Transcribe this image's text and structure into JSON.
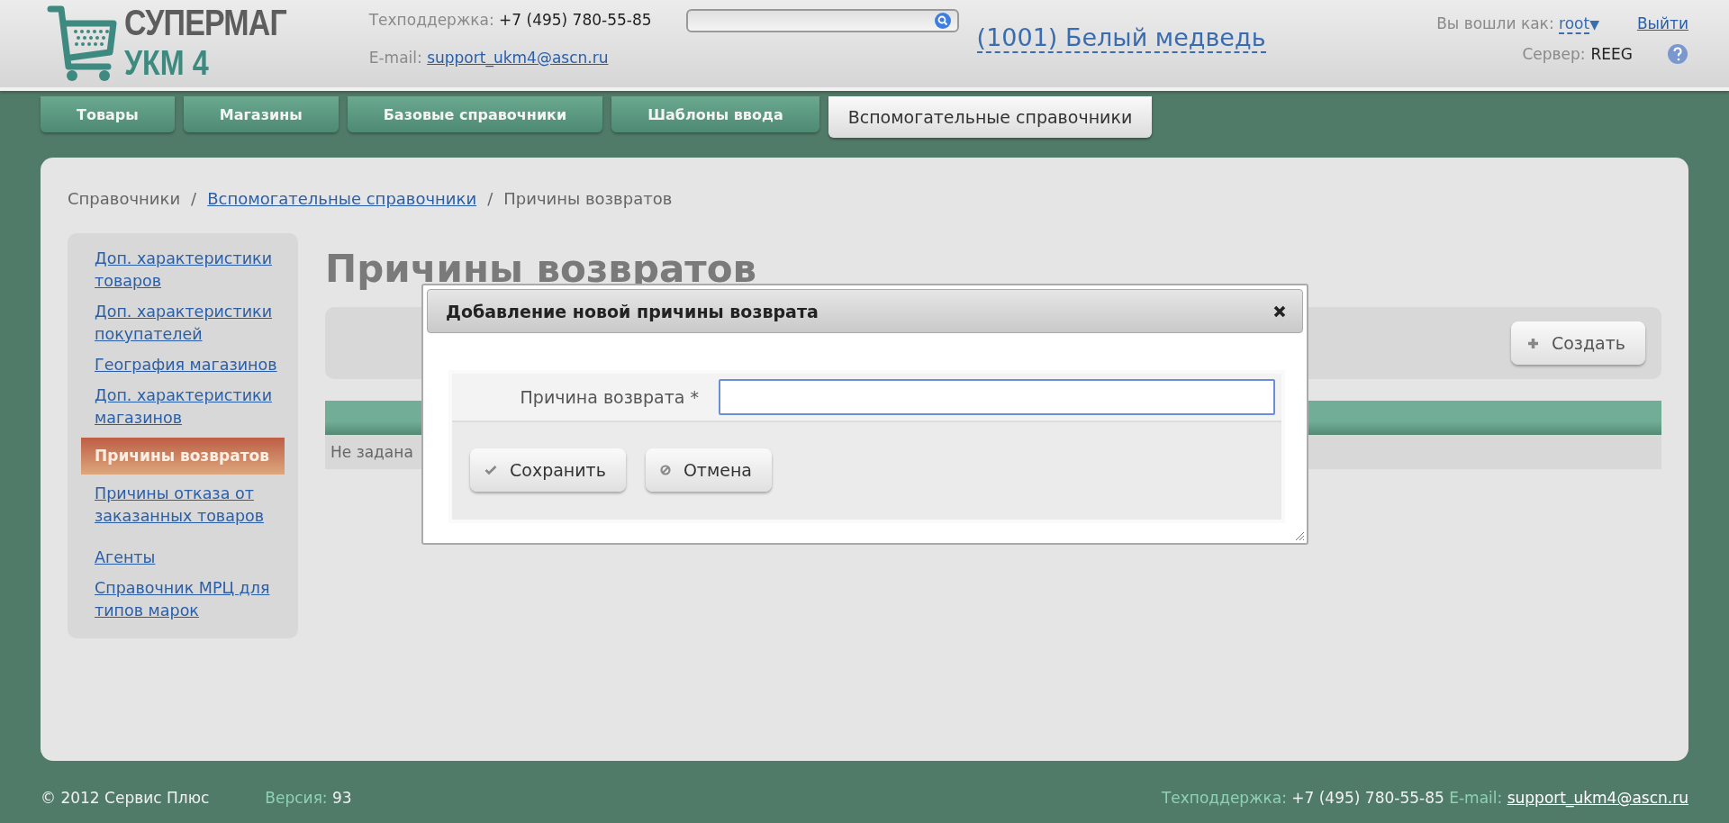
{
  "header": {
    "logo": {
      "line_1": "СУПЕРМАГ",
      "line_2": "УКМ 4"
    },
    "support_label": "Техподдержка:",
    "support_phone": "+7 (495) 780-55-85",
    "email_label": "E-mail:",
    "email": "support_ukm4@ascn.ru",
    "store": "(1001) Белый медведь",
    "user_label": "Вы вошли как:",
    "user": "root",
    "user_caret": "▼",
    "logout": "Выйти",
    "server_label": "Сервер:",
    "server": "REEG"
  },
  "tabs": [
    {
      "label": "Товары",
      "selected": false
    },
    {
      "label": "Магазины",
      "selected": false
    },
    {
      "label": "Базовые справочники",
      "selected": false
    },
    {
      "label": "Шаблоны ввода",
      "selected": false
    },
    {
      "label": "Вспомогательные справочники",
      "selected": true
    }
  ],
  "breadcrumb": {
    "separator": "/",
    "items": [
      {
        "label": "Справочники",
        "link": false
      },
      {
        "label": "Вспомогательные справочники",
        "link": true
      },
      {
        "label": "Причины возвратов",
        "link": false
      }
    ]
  },
  "sidebar": {
    "items": [
      {
        "label": "Доп. характеристики товаров",
        "selected": false
      },
      {
        "label": "Доп. характеристики покупателей",
        "selected": false
      },
      {
        "label": "География магазинов",
        "selected": false
      },
      {
        "label": "Доп. характеристики магазинов",
        "selected": false
      },
      {
        "label": "Причины возвратов",
        "selected": true
      },
      {
        "label": "Причины отказа от заказанных товаров",
        "selected": false
      },
      {
        "label": "Агенты",
        "selected": false
      },
      {
        "label": "Справочник МРЦ для типов марок",
        "selected": false
      }
    ]
  },
  "page": {
    "title": "Причины возвратов",
    "create_button": "Создать",
    "table": {
      "rows": [
        {
          "cell_1": "Не задана"
        }
      ]
    }
  },
  "dialog": {
    "title": "Добавление новой причины возврата",
    "field_label": "Причина возврата *",
    "buttons": [
      {
        "label": "Сохранить",
        "kind": "save"
      },
      {
        "label": "Отмена",
        "kind": "cancel"
      }
    ]
  },
  "footer": {
    "copyright": "© 2012 Сервис Плюс",
    "version_label": "Версия:",
    "version": "93",
    "support_label": "Техподдержка:",
    "support_phone": "+7 (495) 780-55-85",
    "email_label": "E-mail:",
    "email": "support_ukm4@ascn.ru"
  }
}
